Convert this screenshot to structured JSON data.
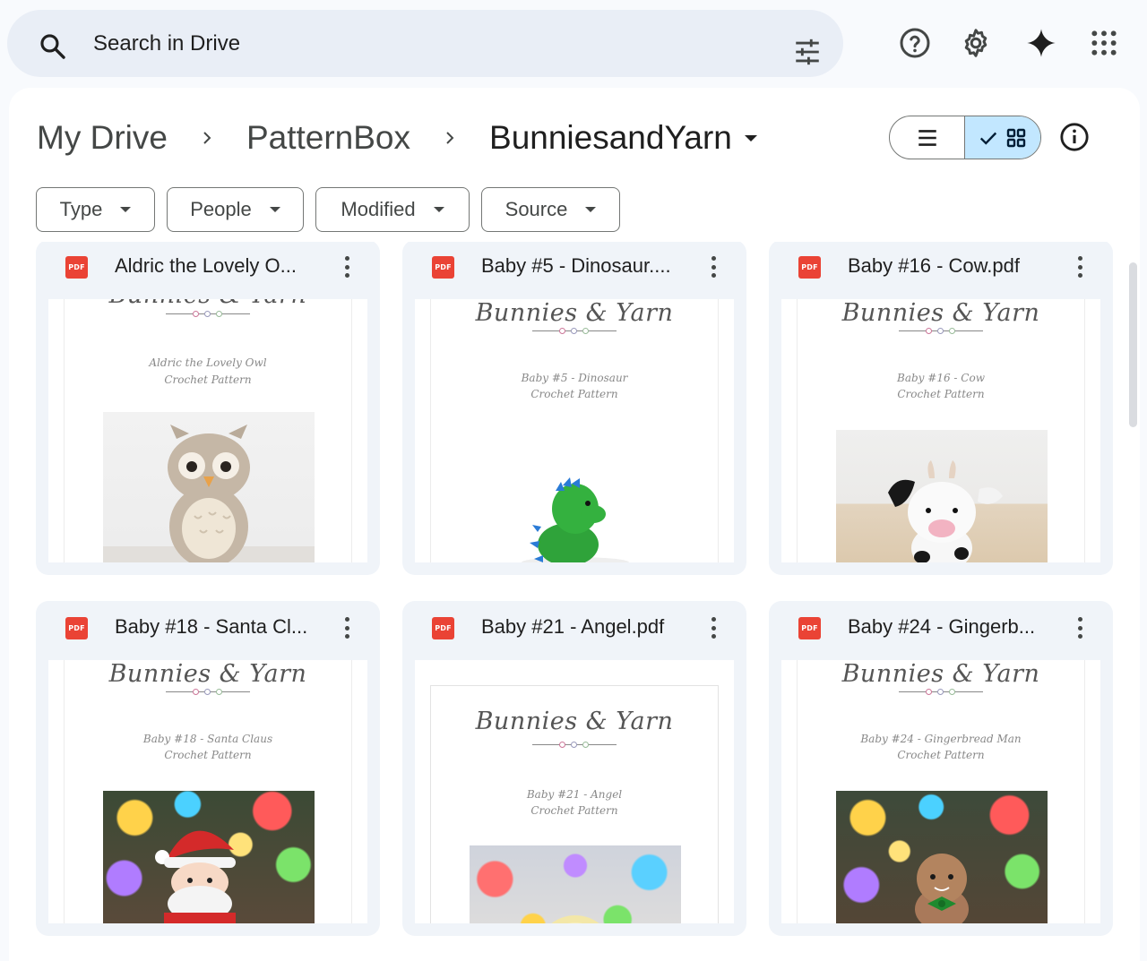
{
  "search": {
    "placeholder": "Search in Drive",
    "icon": "search-icon",
    "filter_icon": "tune-icon"
  },
  "top_icons": [
    "help-icon",
    "settings-icon",
    "gemini-icon",
    "apps-icon"
  ],
  "breadcrumb": {
    "items": [
      "My Drive",
      "PatternBox"
    ],
    "current": "BunniesandYarn"
  },
  "view_toggle": {
    "selected": "grid"
  },
  "filters": [
    "Type",
    "People",
    "Modified",
    "Source"
  ],
  "files": [
    {
      "title": "Aldric the Lovely O...",
      "badge": "PDF",
      "brand": "Bunnies & Yarn",
      "subtitle1": "Aldric the Lovely Owl",
      "subtitle2": "Crochet Pattern"
    },
    {
      "title": "Baby #5 - Dinosaur....",
      "badge": "PDF",
      "brand": "Bunnies & Yarn",
      "subtitle1": "Baby #5 - Dinosaur",
      "subtitle2": "Crochet Pattern"
    },
    {
      "title": "Baby #16 - Cow.pdf",
      "badge": "PDF",
      "brand": "Bunnies & Yarn",
      "subtitle1": "Baby #16 - Cow",
      "subtitle2": "Crochet Pattern"
    },
    {
      "title": "Baby #18 - Santa Cl...",
      "badge": "PDF",
      "brand": "Bunnies & Yarn",
      "subtitle1": "Baby #18 - Santa Claus",
      "subtitle2": "Crochet Pattern"
    },
    {
      "title": "Baby #21 - Angel.pdf",
      "badge": "PDF",
      "brand": "Bunnies & Yarn",
      "subtitle1": "Baby #21 - Angel",
      "subtitle2": "Crochet Pattern"
    },
    {
      "title": "Baby #24 - Gingerb...",
      "badge": "PDF",
      "brand": "Bunnies & Yarn",
      "subtitle1": "Baby #24 - Gingerbread Man",
      "subtitle2": "Crochet Pattern"
    }
  ]
}
